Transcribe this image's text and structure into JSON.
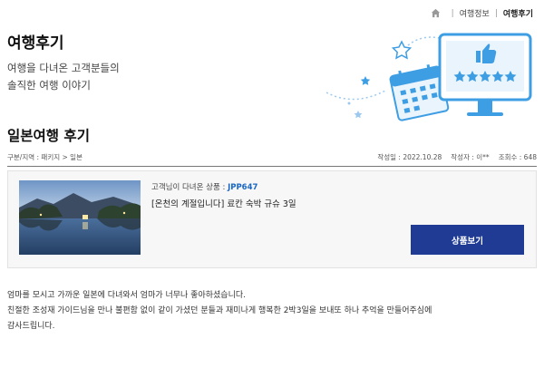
{
  "breadcrumb": {
    "items": [
      "여행정보",
      "여행후기"
    ]
  },
  "hero": {
    "title": "여행후기",
    "desc_line1": "여행을 다녀온 고객분들의",
    "desc_line2": "솔직한 여행 이야기"
  },
  "section_title": "일본여행 후기",
  "meta": {
    "category": "구분/지역 : 패키지 > 일본",
    "date": "작성일 : 2022.10.28",
    "author": "작성자 : 이**",
    "views": "조회수 : 648"
  },
  "product": {
    "code_prefix": "고객님이 다녀온 상품 :",
    "code": "JPP647",
    "name": "[온천의 계절입니다] 료칸 숙박 규슈 3일",
    "button_label": "상품보기"
  },
  "review": {
    "line1": "엄마를 모시고 가까운 일본에 다녀와서 엄마가 너무나 좋아하셨습니다.",
    "line2": "친절한 조성재 가이드님을 만나 불편함 없이 같이 가셨던 분들과 재미나게 행복한 2박3일을 보내또 하나 추억을 만들어주심에",
    "line3": "감사드립니다."
  },
  "colors": {
    "accent": "#1f3b94",
    "code": "#1a67c4",
    "illustration": "#3e9ee3"
  }
}
